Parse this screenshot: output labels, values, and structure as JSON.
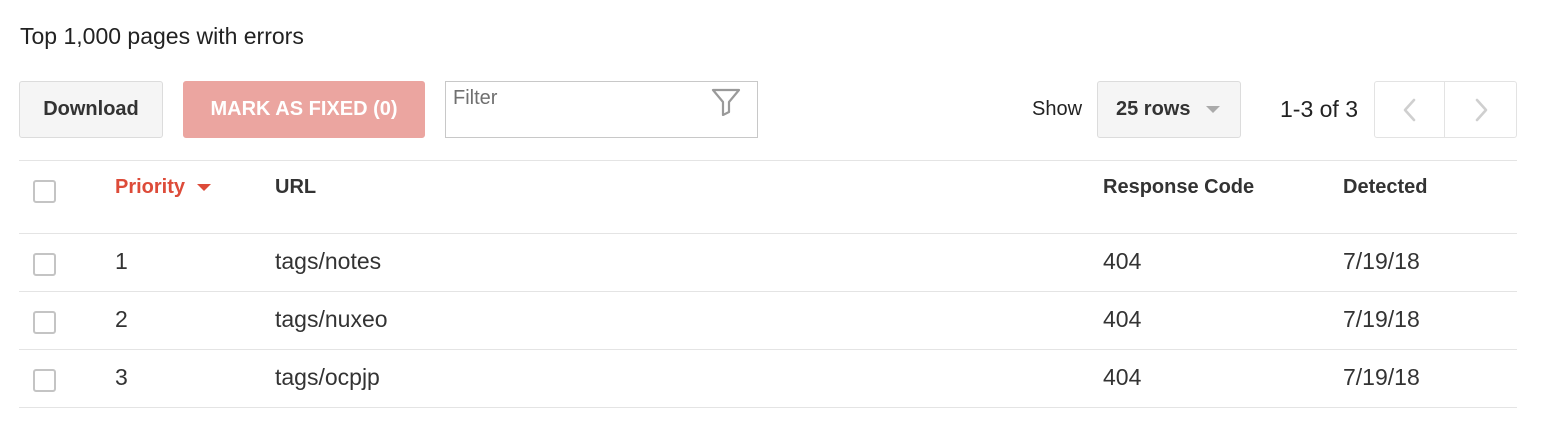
{
  "heading": "Top 1,000 pages with errors",
  "toolbar": {
    "download_label": "Download",
    "mark_fixed_label": "MARK AS FIXED (0)",
    "filter_placeholder": "Filter",
    "filter_icon": "funnel-icon",
    "show_label": "Show",
    "rows_select_value": "25 rows",
    "page_range": "1-3 of 3",
    "prev_icon": "chevron-left-icon",
    "next_icon": "chevron-right-icon"
  },
  "table": {
    "columns": {
      "priority": "Priority",
      "url": "URL",
      "response_code": "Response Code",
      "detected": "Detected"
    },
    "sorted_by": "priority",
    "rows": [
      {
        "priority": "1",
        "url": "tags/notes",
        "response_code": "404",
        "detected": "7/19/18"
      },
      {
        "priority": "2",
        "url": "tags/nuxeo",
        "response_code": "404",
        "detected": "7/19/18"
      },
      {
        "priority": "3",
        "url": "tags/ocpjp",
        "response_code": "404",
        "detected": "7/19/18"
      }
    ]
  },
  "colors": {
    "accent_red": "#dd4b39",
    "disabled_red_button": "#eba5a0",
    "button_gray": "#f5f5f5"
  }
}
